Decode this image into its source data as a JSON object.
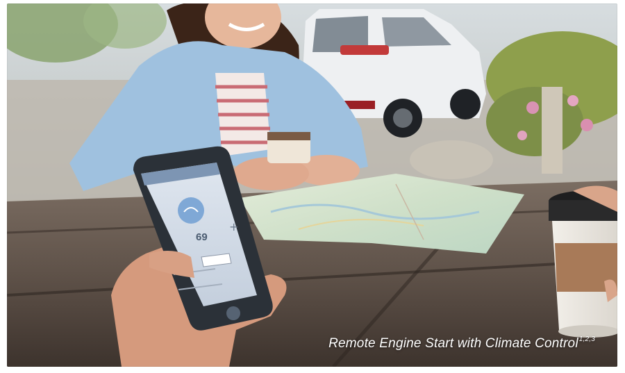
{
  "photo": {
    "caption": "Remote Engine Start with Climate Control",
    "caption_superscript": "1,2,3"
  },
  "phone_screen": {
    "temperature": "69"
  }
}
